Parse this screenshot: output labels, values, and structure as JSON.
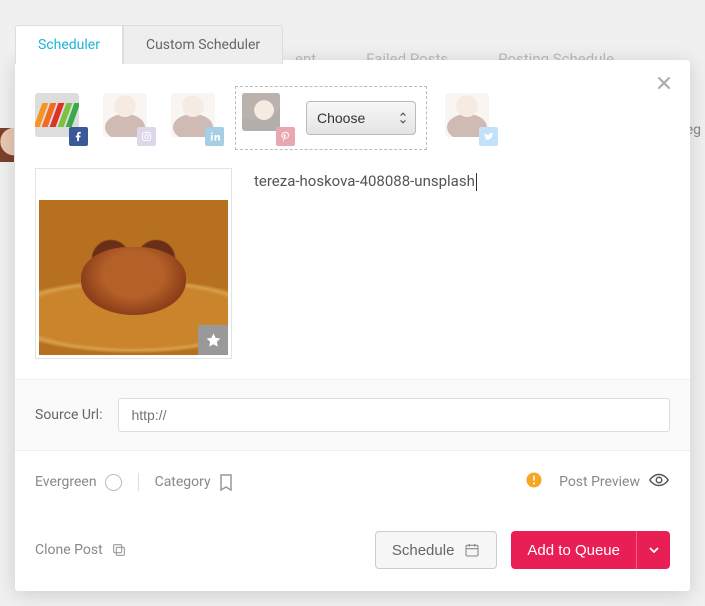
{
  "tabs": {
    "scheduler": "Scheduler",
    "custom": "Custom Scheduler"
  },
  "bg_nav": {
    "item2_suffix": "ent",
    "failed": "Failed Posts",
    "schedule": "Posting Schedule",
    "right_frag": "teg"
  },
  "select": {
    "placeholder": "Choose"
  },
  "caption": "tereza-hoskova-408088-unsplash",
  "source": {
    "label": "Source Url:",
    "placeholder": "http://"
  },
  "options": {
    "evergreen": "Evergreen",
    "category": "Category",
    "preview": "Post Preview"
  },
  "footer": {
    "clone": "Clone Post",
    "schedule": "Schedule",
    "queue": "Add to Queue"
  },
  "colors": {
    "accent_teal": "#1db4d8",
    "accent_pink": "#e91e55",
    "alert_orange": "#f5a623"
  },
  "logo_colors": [
    "#f79421",
    "#f26b21",
    "#e03127",
    "#7cc142",
    "#39a949"
  ]
}
